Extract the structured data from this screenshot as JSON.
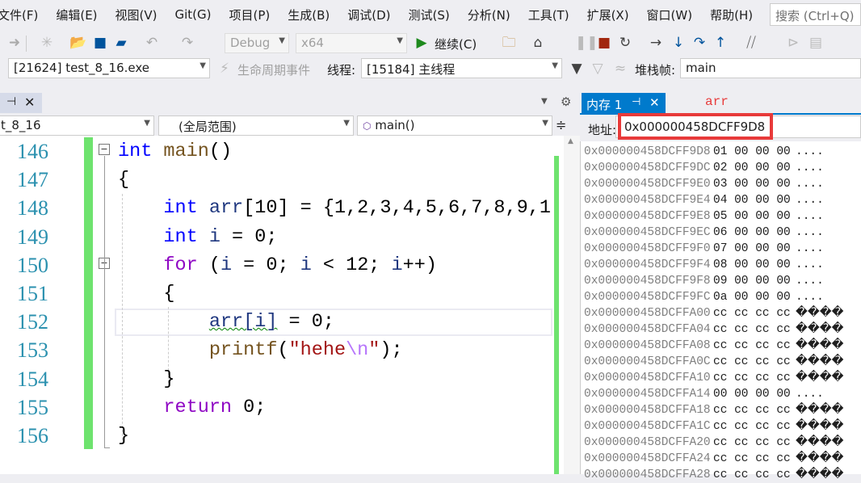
{
  "menu": [
    "文件(F)",
    "编辑(E)",
    "视图(V)",
    "Git(G)",
    "项目(P)",
    "生成(B)",
    "调试(D)",
    "测试(S)",
    "分析(N)",
    "工具(T)",
    "扩展(X)",
    "窗口(W)",
    "帮助(H)"
  ],
  "search": {
    "placeholder": "搜索 (Ctrl+Q)"
  },
  "toolbar": {
    "config": "Debug",
    "platform": "x64",
    "continue": "继续(C)"
  },
  "debugbar": {
    "process": "[21624] test_8_16.exe",
    "lifecycle": "生命周期事件",
    "thread_label": "线程:",
    "thread": "[15184] 主线程",
    "stack_label": "堆栈帧:",
    "stack": "main"
  },
  "nav": {
    "project": "t_8_16",
    "scope": "(全局范围)",
    "function": "main()"
  },
  "editor": {
    "line_numbers": [
      "146",
      "147",
      "148",
      "149",
      "150",
      "151",
      "152",
      "153",
      "154",
      "155",
      "156"
    ],
    "lines": [
      [
        [
          "int",
          "kw"
        ],
        [
          " ",
          "pl"
        ],
        [
          "main",
          "fn"
        ],
        [
          "()",
          "pl"
        ]
      ],
      [
        [
          "{",
          "pl"
        ]
      ],
      [
        [
          "    ",
          "pl"
        ],
        [
          "int",
          "kw"
        ],
        [
          " ",
          "pl"
        ],
        [
          "arr",
          "var"
        ],
        [
          "[10] = {1,2,3,4,5,6,7,8,9,1",
          "pl"
        ]
      ],
      [
        [
          "    ",
          "pl"
        ],
        [
          "int",
          "kw"
        ],
        [
          " ",
          "pl"
        ],
        [
          "i",
          "var"
        ],
        [
          " = 0;",
          "pl"
        ]
      ],
      [
        [
          "    ",
          "pl"
        ],
        [
          "for",
          "ctl"
        ],
        [
          " (",
          "pl"
        ],
        [
          "i",
          "var"
        ],
        [
          " = 0; ",
          "pl"
        ],
        [
          "i",
          "var"
        ],
        [
          " < 12; ",
          "pl"
        ],
        [
          "i",
          "var"
        ],
        [
          "++)",
          "pl"
        ]
      ],
      [
        [
          "    {",
          "pl"
        ]
      ],
      [
        [
          "        ",
          "pl"
        ],
        [
          "arr[i]",
          "var squig"
        ],
        [
          " = 0;",
          "pl"
        ]
      ],
      [
        [
          "        ",
          "pl"
        ],
        [
          "printf",
          "fn"
        ],
        [
          "(",
          "pl"
        ],
        [
          "\"hehe",
          "str"
        ],
        [
          "\\n",
          "esc"
        ],
        [
          "\"",
          "str"
        ],
        [
          ");",
          "pl"
        ]
      ],
      [
        [
          "    }",
          "pl"
        ]
      ],
      [
        [
          "    ",
          "pl"
        ],
        [
          "return",
          "ctl"
        ],
        [
          " 0;",
          "pl"
        ]
      ],
      [
        [
          "}",
          "pl"
        ]
      ]
    ]
  },
  "memory": {
    "tab_label": "内存 1",
    "expression": "arr",
    "address_label": "地址:",
    "address": "0x000000458DCFF9D8",
    "rows": [
      [
        "0x000000458DCFF9D8",
        "01 00 00 00",
        "...."
      ],
      [
        "0x000000458DCFF9DC",
        "02 00 00 00",
        "...."
      ],
      [
        "0x000000458DCFF9E0",
        "03 00 00 00",
        "...."
      ],
      [
        "0x000000458DCFF9E4",
        "04 00 00 00",
        "...."
      ],
      [
        "0x000000458DCFF9E8",
        "05 00 00 00",
        "...."
      ],
      [
        "0x000000458DCFF9EC",
        "06 00 00 00",
        "...."
      ],
      [
        "0x000000458DCFF9F0",
        "07 00 00 00",
        "...."
      ],
      [
        "0x000000458DCFF9F4",
        "08 00 00 00",
        "...."
      ],
      [
        "0x000000458DCFF9F8",
        "09 00 00 00",
        "...."
      ],
      [
        "0x000000458DCFF9FC",
        "0a 00 00 00",
        "...."
      ],
      [
        "0x000000458DCFFA00",
        "cc cc cc cc",
        "����"
      ],
      [
        "0x000000458DCFFA04",
        "cc cc cc cc",
        "����"
      ],
      [
        "0x000000458DCFFA08",
        "cc cc cc cc",
        "����"
      ],
      [
        "0x000000458DCFFA0C",
        "cc cc cc cc",
        "����"
      ],
      [
        "0x000000458DCFFA10",
        "cc cc cc cc",
        "����"
      ],
      [
        "0x000000458DCFFA14",
        "00 00 00 00",
        "...."
      ],
      [
        "0x000000458DCFFA18",
        "cc cc cc cc",
        "����"
      ],
      [
        "0x000000458DCFFA1C",
        "cc cc cc cc",
        "����"
      ],
      [
        "0x000000458DCFFA20",
        "cc cc cc cc",
        "����"
      ],
      [
        "0x000000458DCFFA24",
        "cc cc cc cc",
        "����"
      ],
      [
        "0x000000458DCFFA28",
        "cc cc cc cc",
        "����"
      ]
    ]
  },
  "colors": {
    "accent": "#007acc",
    "highlight_border": "#e83a3a",
    "change_bar": "#6ee36e"
  }
}
